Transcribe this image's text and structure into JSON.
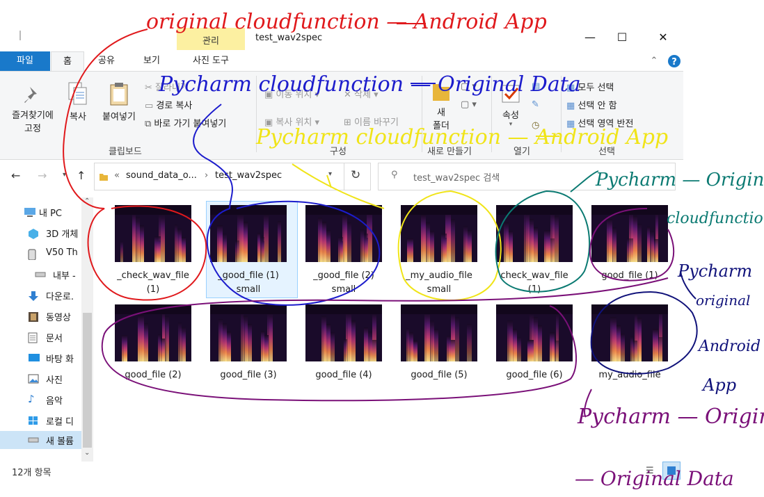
{
  "titlebar": {
    "manage": "관리",
    "title": "test_wav2spec",
    "minimize": "—",
    "maximize": "☐",
    "close": "✕"
  },
  "tabs": {
    "file": "파일",
    "home": "홈",
    "share": "공유",
    "view": "보기",
    "picture_tools": "사진 도구"
  },
  "ribbon": {
    "pin": "즐겨찾기에\n고정",
    "copy": "복사",
    "paste": "붙여넣기",
    "cut": "잘라내기",
    "copy_path": "경로 복사",
    "paste_shortcut": "바로 가기 붙여넣기",
    "move_to": "이동 위치",
    "copy_to": "복사 위치",
    "delete": "삭제",
    "rename": "이름 바꾸기",
    "new_folder": "새\n폴더",
    "properties": "속성",
    "select_all": "모두 선택",
    "select_none": "선택 안 함",
    "invert": "선택 영역 반전",
    "groups": {
      "clipboard": "클립보드",
      "organize": "구성",
      "new": "새로 만들기",
      "open": "열기",
      "select": "선택"
    }
  },
  "address": {
    "sep": "«",
    "parent": "sound_data_o...",
    "current": "test_wav2spec",
    "search_placeholder": "test_wav2spec 검색"
  },
  "nav": [
    {
      "icon": "pc-icon",
      "label": "내 PC"
    },
    {
      "icon": "3d-objects-icon",
      "label": "3D 개체"
    },
    {
      "icon": "phone-icon",
      "label": "V50 Th"
    },
    {
      "icon": "drive-icon",
      "label": "내부 -"
    },
    {
      "icon": "download-icon",
      "label": "다운로."
    },
    {
      "icon": "video-icon",
      "label": "동영상"
    },
    {
      "icon": "document-icon",
      "label": "문서"
    },
    {
      "icon": "desktop-icon",
      "label": "바탕 화"
    },
    {
      "icon": "picture-icon",
      "label": "사진"
    },
    {
      "icon": "music-icon",
      "label": "음악"
    },
    {
      "icon": "local-disk-icon",
      "label": "로컬 디"
    },
    {
      "icon": "new-volume-icon",
      "label": "새 볼륨"
    }
  ],
  "files": [
    {
      "name": "_check_wav_file\n(1)"
    },
    {
      "name": "_good_file (1)\nsmall"
    },
    {
      "name": "_good_file (2)\nsmall"
    },
    {
      "name": "_my_audio_file\nsmall"
    },
    {
      "name": "check_wav_file\n(1)"
    },
    {
      "name": "good_file (1)"
    },
    {
      "name": "good_file (2)"
    },
    {
      "name": "good_file (3)"
    },
    {
      "name": "good_file (4)"
    },
    {
      "name": "good_file (5)"
    },
    {
      "name": "good_file (6)"
    },
    {
      "name": "my_audio_file"
    }
  ],
  "status": "12개 항목",
  "annotations": {
    "red": "original cloudfunction — Android App",
    "blue": "Pycharm cloudfunction — Original Data",
    "yellow": "Pycharm cloudfunction — Android App",
    "teal1": "Pycharm — Original",
    "teal2": "cloudfunction",
    "navy1": "Pycharm",
    "navy2": "original",
    "navy3": "Android",
    "navy4": "App",
    "purple1": "Pycharm — Original",
    "purple2": "— Original Data"
  },
  "colors": {
    "accent": "#1979ca",
    "manage_tab": "#fcf0a1",
    "red_ink": "#e0191c",
    "blue_ink": "#1c1ccc",
    "yellow_ink": "#f0e418",
    "teal_ink": "#0b7a72",
    "navy_ink": "#10127a",
    "purple_ink": "#7a1078"
  }
}
